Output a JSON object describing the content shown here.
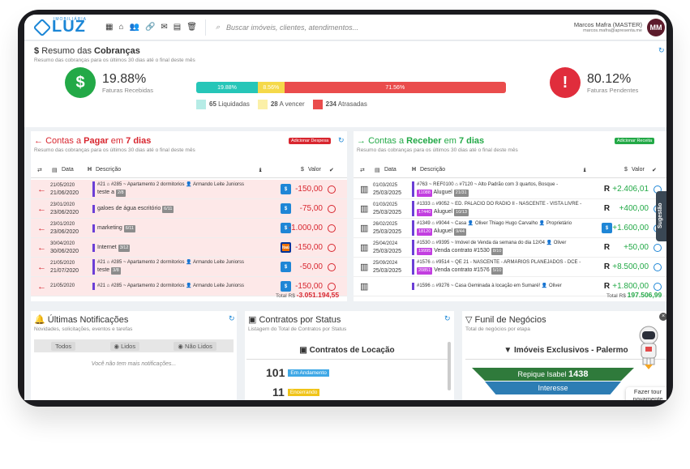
{
  "header": {
    "brand": "LUZ",
    "brand_sub": "IMOBILIÁRIA",
    "search_placeholder": "Buscar imóveis, clientes, atendimentos...",
    "user_name": "Marcos Mafra (MASTER)",
    "user_email": "marcos.mafra@apresenta.me",
    "avatar_initials": "MM",
    "toolbar_icons": [
      "grid-icon",
      "home-icon",
      "users-icon",
      "link-icon",
      "mail-icon",
      "calendar-icon",
      "trash-icon"
    ],
    "notification_badge": "2"
  },
  "resumo": {
    "title_pre": "Resumo das ",
    "title_bold": "Cobranças",
    "subtitle": "Resumo das cobranças para os últimos 30 dias até o final deste mês",
    "received_pct": "19.88%",
    "received_label": "Faturas Recebidas",
    "pending_pct": "80.12%",
    "pending_label": "Faturas Pendentes",
    "bar": [
      {
        "label": "19.88%",
        "fraction": 0.1988,
        "color": "#26c6b8"
      },
      {
        "label": "8.56%",
        "fraction": 0.0856,
        "color": "#f5d94a"
      },
      {
        "label": "71.56%",
        "fraction": 0.7156,
        "color": "#ea4c4c"
      }
    ],
    "legend": [
      {
        "count": "65",
        "label": "Liquidadas",
        "color": "#b6ece6"
      },
      {
        "count": "28",
        "label": "A vencer",
        "color": "#fbf0a8"
      },
      {
        "count": "234",
        "label": "Atrasadas",
        "color": "#ea4c4c"
      }
    ]
  },
  "pagar": {
    "title_pre": "Contas a ",
    "title_bold": "Pagar",
    "title_mid": " em ",
    "title_days": "7 dias",
    "subtitle": "Resumo das cobranças para os últimos 30 dias até o final deste mês",
    "add_label": "Adicionar Despesa",
    "col_data": "Data",
    "col_desc": "Descrição",
    "col_valor": "Valor",
    "rows": [
      {
        "d1": "21/05/2020",
        "d2": "21/06/2020",
        "line1": "#21 ⌂ #285 ~ Apartamento 2 dormitorios  👤 Armando Leite Juniorss",
        "main": "teste a",
        "tag": "2/8",
        "value": "-150,00",
        "bank": "$"
      },
      {
        "d1": "23/01/2020",
        "d2": "23/06/2020",
        "line1": "",
        "main": "galoes de água escritório",
        "tag": "6/11",
        "value": "-75,00",
        "bank": "$"
      },
      {
        "d1": "23/01/2020",
        "d2": "23/06/2020",
        "line1": "",
        "main": "marketing",
        "tag": "6/11",
        "value": "-1.000,00",
        "bank": "$"
      },
      {
        "d1": "30/04/2020",
        "d2": "30/06/2020",
        "line1": "",
        "main": "Internet",
        "tag": "3/12",
        "value": "-150,00",
        "bank": "Itaú"
      },
      {
        "d1": "21/05/2020",
        "d2": "21/07/2020",
        "line1": "#21 ⌂ #285 ~ Apartamento 2 dormitorios  👤 Armando Leite Juniorss",
        "main": "teste",
        "tag": "3/8",
        "value": "-50,00",
        "bank": "$"
      },
      {
        "d1": "21/05/2020",
        "d2": "",
        "line1": "#21 ⌂ #285 ~ Apartamento 2 dormitorios  👤 Armando Leite Juniorss",
        "main": "",
        "tag": "",
        "value": "-150,00",
        "bank": "$"
      }
    ],
    "total_label": "Total R$",
    "total": "-3.051.194,55"
  },
  "receber": {
    "title_pre": "Contas a ",
    "title_bold": "Receber",
    "title_mid": " em ",
    "title_days": "7 dias",
    "subtitle": "Resumo das cobranças para os últimos 30 dias até o final deste mês",
    "add_label": "Adicionar Receita",
    "col_data": "Data",
    "col_desc": "Descrição",
    "col_valor": "Valor",
    "rows": [
      {
        "d1": "01/03/2025",
        "d2": "25/03/2025",
        "line1": "#763 ~ REF0100  ⌂ #7120 ~ Alto Padrão com 3 quartos, Bosque -",
        "code": "11088",
        "main": "Aluguel",
        "tag": "21/31",
        "value": "+2.406,01",
        "bank": "R"
      },
      {
        "d1": "01/03/2025",
        "d2": "25/03/2025",
        "line1": "#1333  ⌂ #9052 ~ ED. PALÁCIO DO RÁDIO II - NASCENTE - VISTA LIVRE -",
        "code": "17440",
        "main": "Aluguel",
        "tag": "10/13",
        "value": "+400,00",
        "bank": "R"
      },
      {
        "d1": "26/02/2025",
        "d2": "25/03/2025",
        "line1": "#1349  ⌂ #9044 ~ Casa  👤 Oliver Thiago Hugo Carvalho  👤 Proprietário",
        "code": "18120",
        "main": "Aluguel",
        "tag": "9/44",
        "value": "+1.600,00",
        "bank": "$"
      },
      {
        "d1": "25/04/2024",
        "d2": "25/03/2025",
        "line1": "#1530  ⌂ #9395 ~ Imóvel de Venda da semana do dia 12/04  👤 Oliver",
        "code": "19995",
        "main": "Venda contrato #1530",
        "tag": "8/10",
        "value": "+50,00",
        "bank": "R"
      },
      {
        "d1": "25/09/2024",
        "d2": "25/03/2025",
        "line1": "#1576  ⌂ #9514 ~ QE 21 - NASCENTE - ARMÁRIOS PLANEJADOS - DCE -",
        "code": "20851",
        "main": "Venda contrato #1576",
        "tag": "5/10",
        "value": "+8.500,00",
        "bank": "R"
      },
      {
        "d1": "",
        "d2": "",
        "line1": "#1596  ⌂ #9276 ~ Casa Geminada à locação em Sumaré!  👤 Oliver",
        "code": "",
        "main": "",
        "tag": "",
        "value": "+1.800,00",
        "bank": "R"
      }
    ],
    "total_label": "Total R$",
    "total": "197.506,99"
  },
  "notificacoes": {
    "title": "Últimas Notificações",
    "subtitle": "Novidades, solicitações, eventos e tarefas",
    "tabs": [
      "Todos",
      "Lidos",
      "Não Lidos"
    ],
    "empty": "Você não tem mais notificações..."
  },
  "contratos": {
    "title": "Contratos por Status",
    "subtitle": "Listagem do Total de Contratos por Status",
    "section": "Contratos de Locação",
    "items": [
      {
        "count": "101",
        "status": "Em Andamento",
        "color": "#3fa8e6"
      },
      {
        "count": "11",
        "status": "Encerrando",
        "color": "#f0c419"
      }
    ]
  },
  "funil": {
    "title": "Funil de Negócios",
    "subtitle": "Total de negócios por etapa",
    "section": "Imóveis Exclusivos - Palermo",
    "stage1_label": "Repique Isabel",
    "stage1_count": "1438",
    "stage2_label": "Interesse"
  },
  "widgets": {
    "tour": "Fazer tour novamente",
    "sugestao": "Sugestão"
  }
}
